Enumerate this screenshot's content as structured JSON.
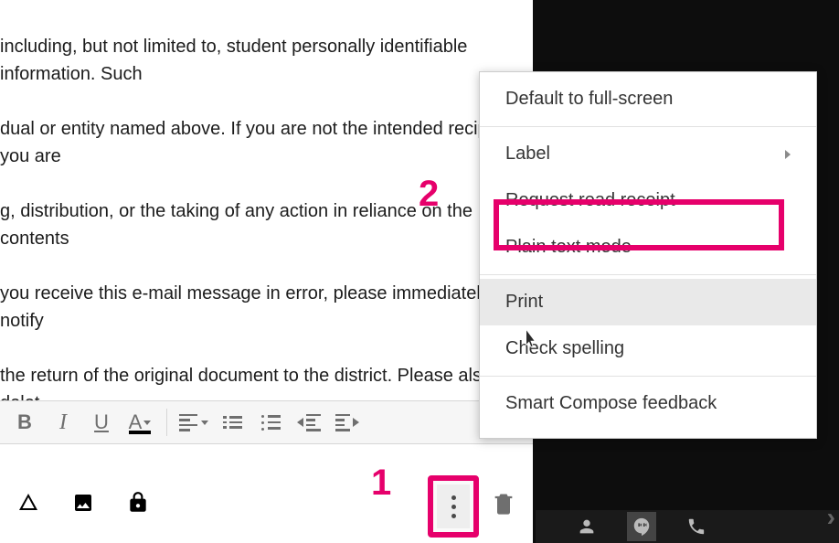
{
  "email": {
    "body_lines": [
      " including, but not limited to, student personally identifiable information. Such",
      "dual or entity named above. If you are not the intended recipient, you are",
      "g, distribution, or the taking of any action in reliance on the contents",
      "you receive this e-mail message in error, please immediately notify",
      " the return of the original document to the district. Please also delet"
    ]
  },
  "toolbar": {
    "bold": "B",
    "italic": "I",
    "underline": "U",
    "textcolor": "A"
  },
  "menu": {
    "default_fullscreen": "Default to full-screen",
    "label": "Label",
    "request_read_receipt": "Request read receipt",
    "plain_text": "Plain text mode",
    "print": "Print",
    "check_spelling": "Check spelling",
    "smart_compose": "Smart Compose feedback"
  },
  "annotations": {
    "step1": "1",
    "step2": "2"
  },
  "icons": {
    "drive": "drive-icon",
    "image": "image-icon",
    "clock": "confidential-mode-icon",
    "more": "more-options-icon",
    "trash": "discard-draft-icon",
    "hangouts_contact": "contacts-icon",
    "hangouts_chat": "hangouts-icon",
    "phone": "phone-icon"
  }
}
